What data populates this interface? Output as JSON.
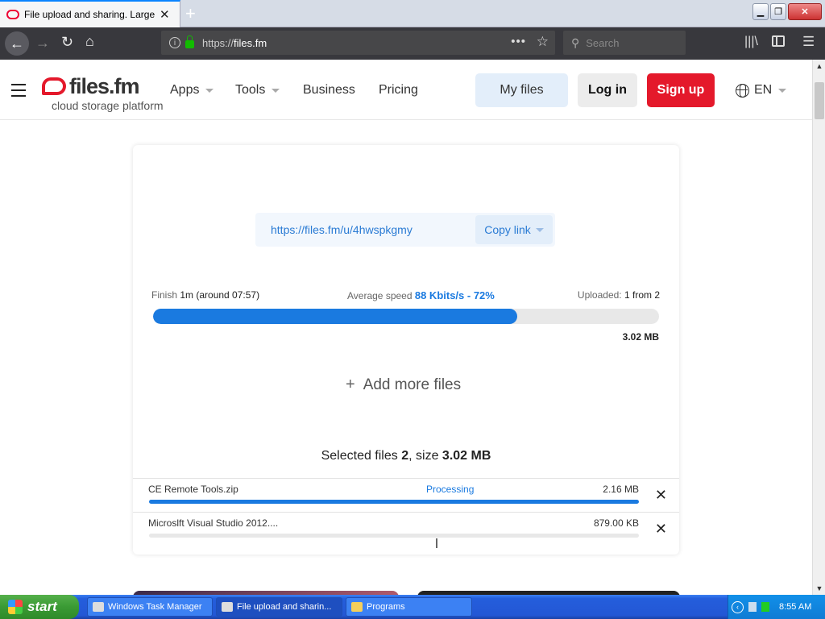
{
  "browser": {
    "tab_title": "File upload and sharing. Large file",
    "url_prefix": "https://",
    "url_host": "files.fm",
    "search_placeholder": "Search"
  },
  "header": {
    "logo_name": "files.fm",
    "logo_tagline": "cloud storage platform",
    "nav": [
      {
        "label": "Apps"
      },
      {
        "label": "Tools"
      },
      {
        "label": "Business"
      },
      {
        "label": "Pricing"
      }
    ],
    "my_files": "My files",
    "log_in": "Log in",
    "sign_up": "Sign up",
    "language": "EN"
  },
  "upload": {
    "share_url": "https://files.fm/u/4hwspkgmy",
    "copy_link": "Copy link",
    "finish_label": "Finish",
    "finish_value": "1m (around 07:57)",
    "speed_label": "Average speed",
    "speed_value": "88 Kbits/s - 72%",
    "uploaded_label": "Uploaded:",
    "uploaded_value": "1 from 2",
    "progress_percent": 72,
    "total_size": "3.02 MB",
    "add_more": "Add more files",
    "selected_label": "Selected files",
    "selected_count": "2",
    "size_label": ", size",
    "selected_size": "3.02 MB",
    "files": [
      {
        "name": "CE Remote Tools.zip",
        "status": "Processing",
        "size": "2.16 MB",
        "progress_percent": 100
      },
      {
        "name": "Microslft Visual Studio 2012....",
        "status": "",
        "size": "879.00 KB",
        "progress_percent": 0
      }
    ]
  },
  "taskbar": {
    "start": "start",
    "tasks": [
      {
        "label": "Windows Task Manager"
      },
      {
        "label": "File upload and sharin..."
      },
      {
        "label": "Programs"
      }
    ],
    "clock": "8:55 AM"
  },
  "colors": {
    "brand_red": "#e4192b",
    "accent_blue": "#1a7ae0"
  }
}
